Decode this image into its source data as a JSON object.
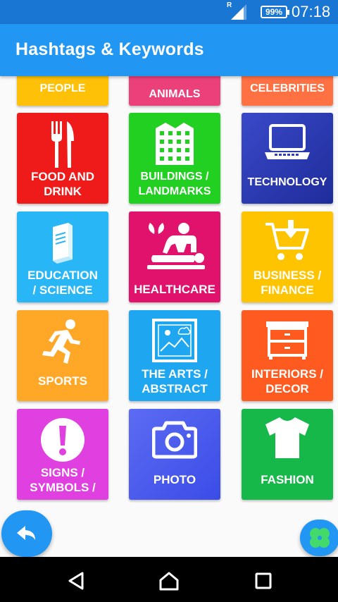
{
  "status": {
    "signal_badge": "R",
    "battery": "99%",
    "time": "07:18"
  },
  "header": {
    "title": "Hashtags & Keywords"
  },
  "categories": [
    {
      "label": "PEOPLE",
      "color": "#ffc107",
      "icon": "people-icon"
    },
    {
      "label": "ANIMALS",
      "color": "#ec407a",
      "icon": "animals-icon"
    },
    {
      "label": "CELEBRITIES",
      "color": "#ff7043",
      "icon": "celebrities-icon"
    },
    {
      "label": "FOOD AND\nDRINK",
      "color": "#ef1b1b",
      "icon": "fork-knife-icon"
    },
    {
      "label": "BUILDINGS /\nLANDMARKS",
      "color": "#22d022",
      "icon": "building-icon"
    },
    {
      "label": "TECHNOLOGY",
      "color": "#2f3fb8",
      "icon": "laptop-icon"
    },
    {
      "label": "EDUCATION\n/ SCIENCE",
      "color": "#29b6f6",
      "icon": "book-icon"
    },
    {
      "label": "HEALTHCARE",
      "color": "#e0126c",
      "icon": "massage-icon"
    },
    {
      "label": "BUSINESS /\nFINANCE",
      "color": "#ffc400",
      "icon": "cart-icon"
    },
    {
      "label": "SPORTS",
      "color": "#ffa726",
      "icon": "running-icon"
    },
    {
      "label": "THE ARTS /\nABSTRACT",
      "color": "#1ea7f0",
      "icon": "picture-icon"
    },
    {
      "label": "INTERIORS /\nDECOR",
      "color": "#ff5a1f",
      "icon": "dresser-icon"
    },
    {
      "label": "SIGNS /\nSYMBOLS /",
      "color": "#e040e0",
      "icon": "exclamation-icon"
    },
    {
      "label": "PHOTO",
      "color": "#4a5cf0",
      "icon": "camera-icon"
    },
    {
      "label": "FASHION",
      "color": "#17b84a",
      "icon": "tshirt-icon"
    }
  ],
  "nav": {
    "back": "back-icon",
    "home": "home-icon",
    "recents": "recents-icon"
  }
}
